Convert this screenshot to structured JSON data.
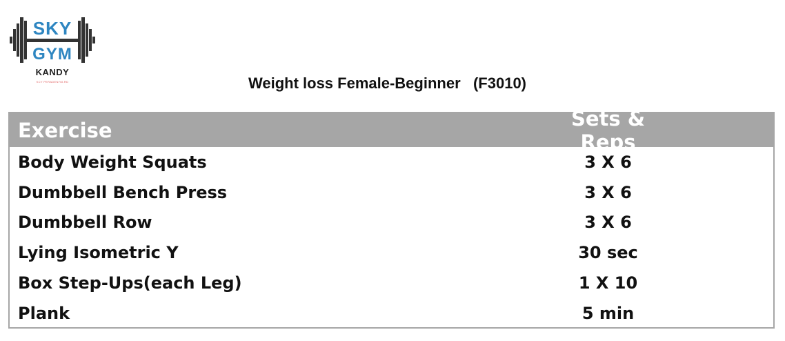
{
  "logo": {
    "brand_top": "SKY",
    "brand_bottom": "GYM",
    "city": "KANDY",
    "tagline": "KCY PERADENIYA RD"
  },
  "title": "Weight loss Female-Beginner   (F3010)",
  "table": {
    "headers": {
      "exercise": "Exercise",
      "sets_reps": "Sets & Reps"
    },
    "rows": [
      {
        "exercise": "Body Weight Squats",
        "sets_reps": "3 X 6"
      },
      {
        "exercise": "Dumbbell Bench Press",
        "sets_reps": "3 X 6"
      },
      {
        "exercise": "Dumbbell Row",
        "sets_reps": "3 X 6"
      },
      {
        "exercise": "Lying Isometric Y",
        "sets_reps": "30 sec"
      },
      {
        "exercise": "Box Step-Ups(each Leg)",
        "sets_reps": "1 X 10"
      },
      {
        "exercise": "Plank",
        "sets_reps": "5 min"
      }
    ]
  },
  "colors": {
    "brand_blue": "#2e86c1",
    "dumbbell": "#333333",
    "header_bg": "#a6a6a6",
    "header_text": "#ffffff"
  }
}
